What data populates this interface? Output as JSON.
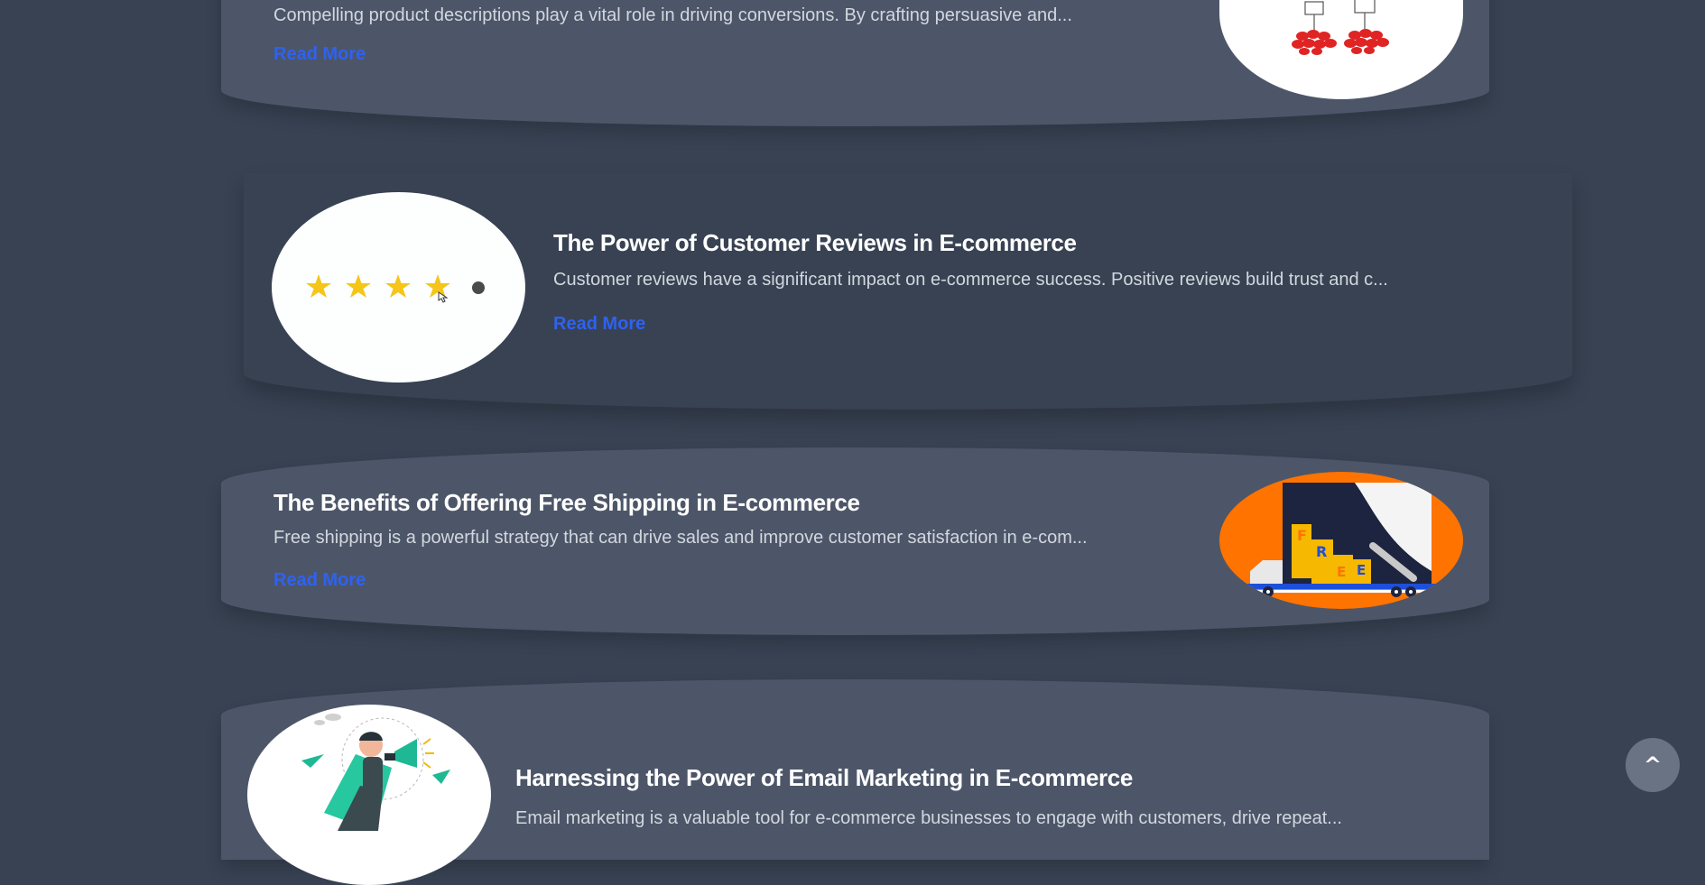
{
  "posts": [
    {
      "title": "",
      "excerpt": "Compelling product descriptions play a vital role in driving conversions. By crafting persuasive and...",
      "read_more": "Read More",
      "image_icon": "product-comparison-illustration"
    },
    {
      "title": "The Power of Customer Reviews in E-commerce",
      "excerpt": "Customer reviews have a significant impact on e-commerce success. Positive reviews build trust and c...",
      "read_more": "Read More",
      "image_icon": "star-rating-illustration",
      "rating": {
        "filled_stars": 4,
        "total": 5
      }
    },
    {
      "title": "The Benefits of Offering Free Shipping in E-commerce",
      "excerpt": "Free shipping is a powerful strategy that can drive sales and improve customer satisfaction in e-com...",
      "read_more": "Read More",
      "image_icon": "free-shipping-truck-illustration",
      "image_text": "FREE"
    },
    {
      "title": "Harnessing the Power of Email Marketing in E-commerce",
      "excerpt": "Email marketing is a valuable tool for e-commerce businesses to engage with customers, drive repeat...",
      "read_more": "Read More",
      "image_icon": "megaphone-marketing-illustration"
    }
  ],
  "scroll_top": {
    "label": "^",
    "icon": "chevron-up-icon"
  },
  "colors": {
    "page_background": "#384253",
    "card_background": "#4d5668",
    "link": "#2f62ee",
    "star": "#f5c518",
    "shipping_orange": "#ff7300"
  }
}
